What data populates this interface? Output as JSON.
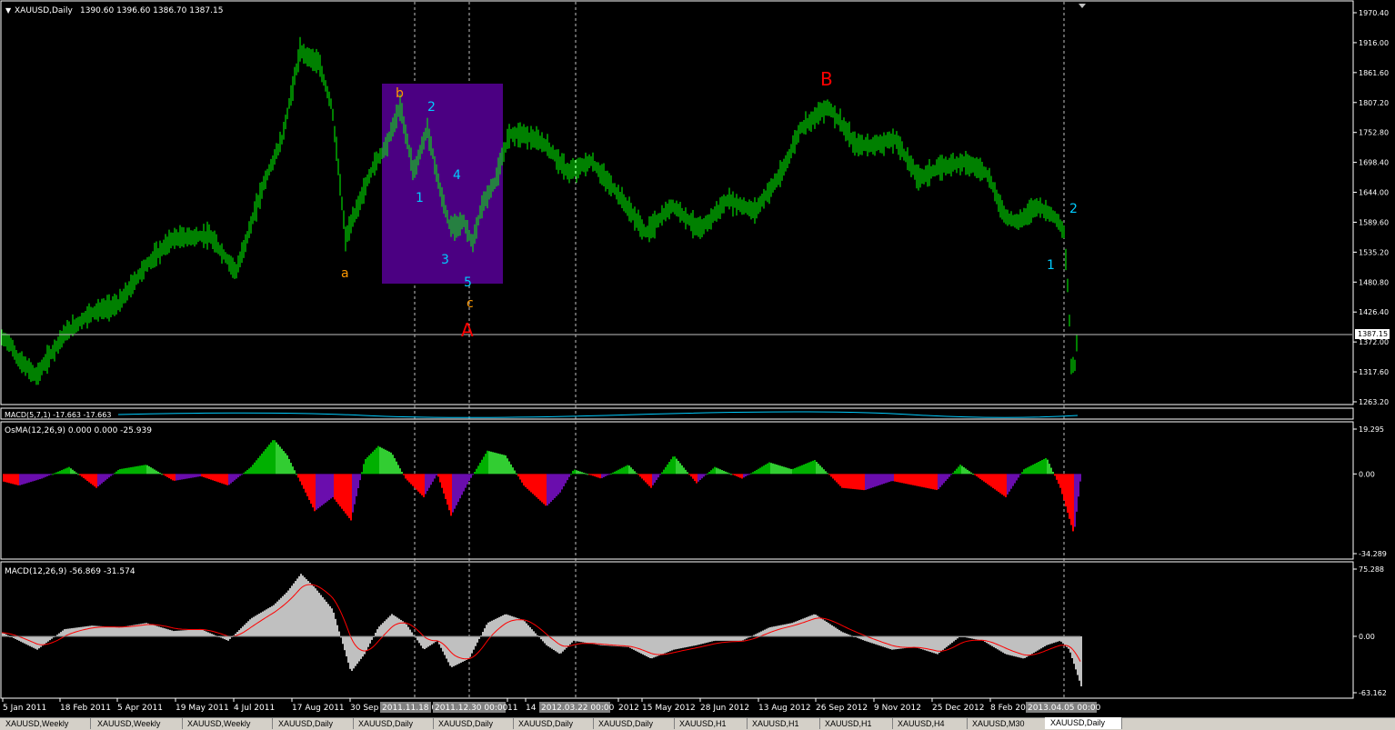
{
  "colors": {
    "background": "#000000",
    "grid": "#ffffff",
    "candle": "#00ff00",
    "price_line": "#c0c0c0",
    "box": "#4b0082",
    "label_orange": "#ff9900",
    "label_cyan": "#00ccff",
    "label_red": "#ff0000",
    "macd_hist": "#c0c0c0",
    "macd_signal": "#ff0000",
    "osma_up_green": "#00b000",
    "osma_up_lime": "#32cd32",
    "osma_down_red": "#ff0000",
    "osma_down_purple": "#6a0dad",
    "macd571_line": "#00ccff"
  },
  "chart_data": [
    {
      "type": "line",
      "name": "price",
      "title": "XAUUSD,Daily",
      "ohlc_readout": "1390.60 1396.60 1386.70 1387.15",
      "current_price_label": "1387.15",
      "yticks": [
        "1970.40",
        "1916.00",
        "1861.60",
        "1807.20",
        "1752.80",
        "1698.40",
        "1644.00",
        "1589.60",
        "1535.20",
        "1480.80",
        "1426.40",
        "1372.00",
        "1317.60",
        "1263.20"
      ],
      "ylim": [
        1263.2,
        1970.4
      ],
      "x": [
        0,
        10,
        20,
        40,
        70,
        100,
        130,
        160,
        190,
        230,
        260,
        290,
        310,
        330,
        350,
        365,
        380,
        395,
        410,
        425,
        440,
        455,
        470,
        485,
        495,
        510,
        520,
        530,
        545,
        560,
        575,
        600,
        625,
        650,
        680,
        710,
        740,
        770,
        800,
        830,
        860,
        880,
        895,
        910,
        925,
        940,
        960,
        985,
        1010,
        1035,
        1060,
        1085,
        1105,
        1120,
        1140,
        1160,
        1170,
        1175,
        1178,
        1182,
        1185
      ],
      "y": [
        1380,
        1372,
        1340,
        1310,
        1385,
        1425,
        1440,
        1510,
        1560,
        1565,
        1500,
        1660,
        1740,
        1900,
        1880,
        1800,
        1560,
        1625,
        1690,
        1730,
        1800,
        1680,
        1760,
        1640,
        1580,
        1590,
        1550,
        1620,
        1665,
        1750,
        1750,
        1730,
        1680,
        1700,
        1640,
        1570,
        1620,
        1575,
        1630,
        1610,
        1680,
        1760,
        1780,
        1800,
        1770,
        1730,
        1730,
        1740,
        1670,
        1690,
        1700,
        1680,
        1600,
        1590,
        1620,
        1600,
        1570,
        1450,
        1330,
        1330,
        1387
      ]
    },
    {
      "type": "area",
      "name": "MACD(5,7,1) -17.663 -17.663"
    },
    {
      "type": "bar",
      "name": "OsMA(12,26,9) 0.000 0.000 -25.939",
      "yticks": [
        "19.295",
        "0.00",
        "-34.289"
      ],
      "ylim": [
        -34.289,
        19.295
      ],
      "x": [
        0,
        20,
        45,
        75,
        105,
        130,
        160,
        190,
        220,
        250,
        275,
        300,
        315,
        330,
        345,
        365,
        385,
        400,
        415,
        430,
        445,
        465,
        480,
        495,
        515,
        535,
        555,
        575,
        600,
        615,
        630,
        660,
        690,
        715,
        740,
        765,
        785,
        815,
        845,
        870,
        895,
        925,
        950,
        980,
        1005,
        1030,
        1055,
        1080,
        1105,
        1125,
        1150,
        1165,
        1180,
        1188
      ],
      "y": [
        -3,
        -5,
        -2,
        3,
        -6,
        2,
        4,
        -3,
        -1,
        -5,
        3,
        15,
        8,
        -4,
        -16,
        -10,
        -20,
        6,
        12,
        9,
        -2,
        -10,
        0,
        -18,
        -3,
        10,
        8,
        -5,
        -14,
        -8,
        2,
        -2,
        4,
        -6,
        8,
        -4,
        3,
        -2,
        5,
        2,
        6,
        -6,
        -7,
        -3,
        -5,
        -7,
        4,
        -3,
        -10,
        2,
        7,
        -6,
        -26,
        0
      ]
    },
    {
      "type": "area",
      "name": "MACD(12,26,9) -56.869 -31.574",
      "yticks": [
        "75.288",
        "0.00",
        "-63.162"
      ],
      "ylim": [
        -63.162,
        75.288
      ],
      "x": [
        0,
        20,
        40,
        70,
        100,
        130,
        160,
        190,
        220,
        250,
        275,
        300,
        315,
        330,
        345,
        365,
        385,
        400,
        415,
        430,
        445,
        465,
        480,
        495,
        515,
        535,
        555,
        575,
        600,
        615,
        630,
        660,
        690,
        715,
        740,
        765,
        785,
        815,
        845,
        870,
        895,
        925,
        950,
        980,
        1005,
        1030,
        1055,
        1080,
        1105,
        1125,
        1150,
        1165,
        1175,
        1188
      ],
      "y": [
        5,
        -5,
        -15,
        8,
        12,
        10,
        15,
        6,
        8,
        -5,
        20,
        35,
        50,
        70,
        55,
        30,
        -40,
        -20,
        10,
        25,
        15,
        -15,
        -5,
        -35,
        -25,
        15,
        25,
        18,
        -10,
        -20,
        -5,
        -10,
        -12,
        -25,
        -15,
        -10,
        -5,
        -5,
        10,
        15,
        25,
        5,
        -5,
        -15,
        -12,
        -20,
        0,
        -5,
        -20,
        -25,
        -10,
        -5,
        -15,
        -56
      ]
    }
  ],
  "wave_labels": [
    {
      "text": "a",
      "color": "orange"
    },
    {
      "text": "b",
      "color": "orange"
    },
    {
      "text": "c",
      "color": "orange"
    },
    {
      "text": "1",
      "color": "cyan"
    },
    {
      "text": "2",
      "color": "cyan"
    },
    {
      "text": "3",
      "color": "cyan"
    },
    {
      "text": "4",
      "color": "cyan"
    },
    {
      "text": "5",
      "color": "cyan"
    },
    {
      "text": "A",
      "color": "red"
    },
    {
      "text": "B",
      "color": "red"
    },
    {
      "text": "1",
      "color": "cyan"
    },
    {
      "text": "2",
      "color": "cyan"
    }
  ],
  "xticks": [
    "5 Jan 2011",
    "18 Feb 2011",
    "5 Apr 2011",
    "19 May 2011",
    "4 Jul 2011",
    "17 Aug 2011",
    "30 Sep",
    "11",
    "14",
    "2012",
    "15 May 2012",
    "28 Jun 2012",
    "13 Aug 2012",
    "26 Sep 2012",
    "9 Nov 2012",
    "25 Dec 2012",
    "8 Feb 20"
  ],
  "xtick_highlights": [
    "2011.11.18 0",
    "2011.12.30 00:00",
    "2012.03.22 00:00",
    "2013.04.05 00:00"
  ],
  "tabs": [
    "XAUUSD,Weekly",
    "XAUUSD,Weekly",
    "XAUUSD,Weekly",
    "XAUUSD,Daily",
    "XAUUSD,Daily",
    "XAUUSD,Daily",
    "XAUUSD,Daily",
    "XAUUSD,Daily",
    "XAUUSD,H1",
    "XAUUSD,H1",
    "XAUUSD,H1",
    "XAUUSD,H4",
    "XAUUSD,M30",
    "XAUUSD,Daily"
  ]
}
